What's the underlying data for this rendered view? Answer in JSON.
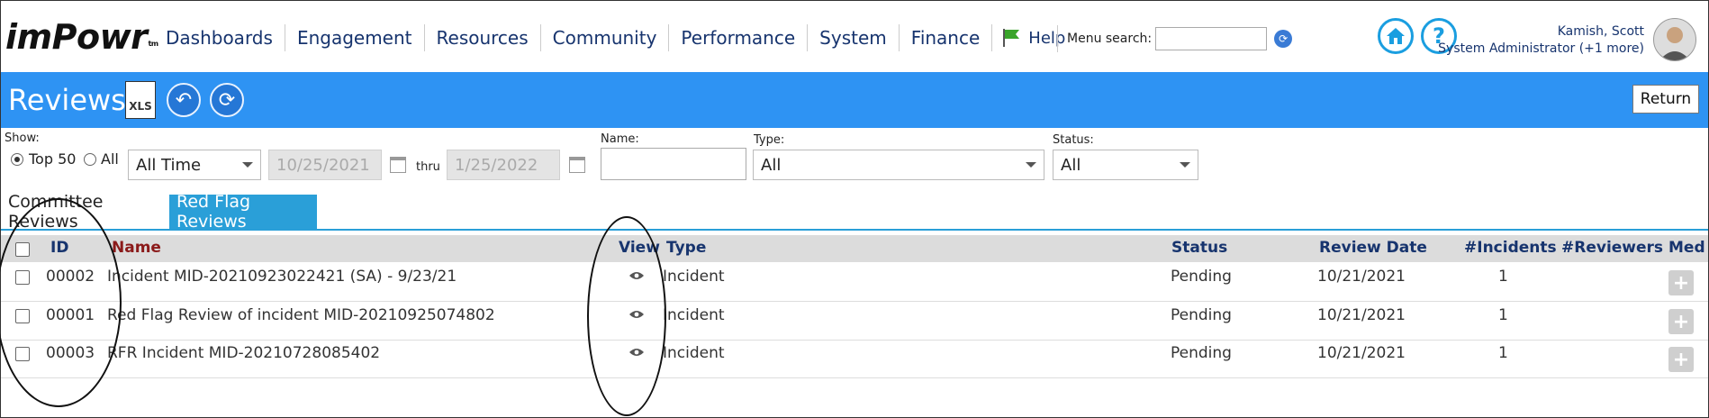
{
  "app": {
    "logo": "imPowr",
    "logo_tm": "tm"
  },
  "nav": {
    "items": [
      "Dashboards",
      "Engagement",
      "Resources",
      "Community",
      "Performance",
      "System",
      "Finance"
    ],
    "help": "Help",
    "menu_search_label": "Menu search:",
    "menu_search_value": ""
  },
  "user": {
    "name": "Kamish, Scott",
    "role": "System Administrator (+1 more)"
  },
  "page": {
    "title": "Reviews",
    "xls_label": "XLS",
    "return_label": "Return"
  },
  "filters": {
    "show_label": "Show:",
    "opt_top50": "Top 50",
    "opt_all": "All",
    "selected": "Top 50",
    "range": "All Time",
    "date_from": "10/25/2021",
    "thru": "thru",
    "date_to": "1/25/2022",
    "name_label": "Name:",
    "name_value": "",
    "type_label": "Type:",
    "type_value": "All",
    "status_label": "Status:",
    "status_value": "All"
  },
  "tabs": [
    {
      "label": "Committee Reviews",
      "active": false
    },
    {
      "label": "Red Flag Reviews",
      "active": true
    }
  ],
  "columns": [
    "ID",
    "Name",
    "View",
    "Type",
    "Status",
    "Review Date",
    "#Incidents",
    "#Reviewers",
    "Med"
  ],
  "rows": [
    {
      "id": "00002",
      "name": "Incident MID-20210923022421 (SA) - 9/23/21",
      "type": "Incident",
      "status": "Pending",
      "review_date": "10/21/2021",
      "incidents": "1",
      "reviewers": ""
    },
    {
      "id": "00001",
      "name": "Red Flag Review of incident MID-20210925074802",
      "type": "Incident",
      "status": "Pending",
      "review_date": "10/21/2021",
      "incidents": "1",
      "reviewers": ""
    },
    {
      "id": "00003",
      "name": "RFR Incident MID-20210728085402",
      "type": "Incident",
      "status": "Pending",
      "review_date": "10/21/2021",
      "incidents": "1",
      "reviewers": ""
    }
  ],
  "colors": {
    "brand_blue": "#2e93f3",
    "tab_blue": "#2a9fd8",
    "header_text": "#17346e",
    "name_header": "#8b1a1a"
  },
  "icons": [
    "flag-icon",
    "refresh-icon",
    "home-icon",
    "help-icon",
    "xls-icon",
    "back-icon",
    "calendar-icon",
    "eye-icon",
    "plus-icon"
  ]
}
